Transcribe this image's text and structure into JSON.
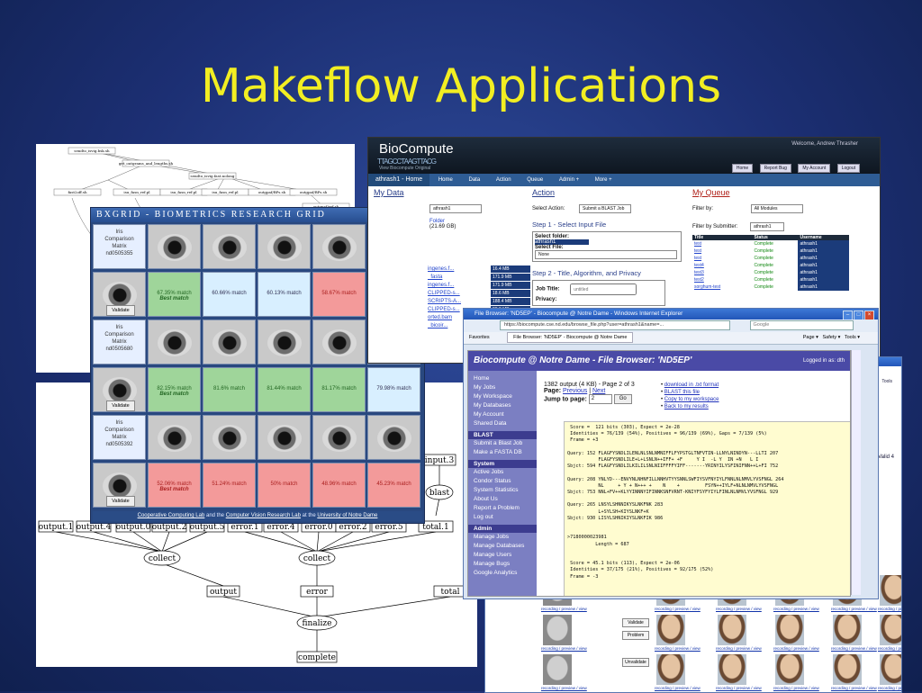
{
  "slide": {
    "title": "Makeflow Applications"
  },
  "workflow_top": {
    "nodes": [
      "sendto_isvig.bsk.sh",
      "get_outgrams_and_lengths.sh",
      "sendto_isvig.fast.nolong",
      "fast2off.sh",
      "isu_fasn_ref.pl",
      "isu_fasn_ref.pl",
      "isu_fasn_ref.pl",
      "outgpaf/BPs.sh",
      "outgpaf/BPs.sh",
      "outgpaf/ref.sh"
    ]
  },
  "workflow_bottom": {
    "top_nodes": [
      "input.3",
      "blast"
    ],
    "outputs": [
      "output.1",
      "output.4",
      "output.0",
      "output.2",
      "output.5",
      "error.1",
      "error.4",
      "error.0",
      "error.2",
      "error.5",
      "total.1"
    ],
    "collectors": [
      "collect",
      "collect"
    ],
    "mid": [
      "output",
      "error",
      "total"
    ],
    "finalize": "finalize",
    "complete": "complete"
  },
  "bxgrid": {
    "header": "BXGRID - BIOMETRICS RESEARCH GRID",
    "rows": [
      {
        "label": [
          "Iris",
          "Comparison",
          "Matrix",
          "nd0505355"
        ],
        "cells": [
          {
            "text": "67.35% match",
            "best": "Best match",
            "style": "pct-g"
          },
          {
            "text": "60.66% match",
            "style": "pct-b"
          },
          {
            "text": "60.13% match",
            "style": "pct-b"
          },
          {
            "text": "58.67% match",
            "style": "pct-r"
          },
          {
            "text": "56.33% match",
            "style": "pct-r"
          }
        ]
      },
      {
        "label": [
          "Iris",
          "Comparison",
          "Matrix",
          "nd0505680"
        ],
        "cells": [
          {
            "text": "82.15% match",
            "best": "Best match",
            "style": "pct-g"
          },
          {
            "text": "81.6% match",
            "style": "pct-g"
          },
          {
            "text": "81.44% match",
            "style": "pct-g"
          },
          {
            "text": "81.17% match",
            "style": "pct-g"
          },
          {
            "text": "79.98% match",
            "style": "pct-b"
          }
        ]
      },
      {
        "label": [
          "Iris",
          "Comparison",
          "Matrix",
          "nd0505392"
        ],
        "cells": [
          {
            "text": "52.06% match",
            "best": "Best match",
            "style": "pct-r"
          },
          {
            "text": "51.24% match",
            "style": "pct-r"
          },
          {
            "text": "50% match",
            "style": "pct-r"
          },
          {
            "text": "48.96% match",
            "style": "pct-r"
          },
          {
            "text": "45.23% match",
            "style": "pct-r"
          }
        ]
      }
    ],
    "validate_label": "Validate",
    "footer": {
      "lab1": "Cooperative Computing Lab",
      "and": "and the",
      "lab2": "Computer Vision Research Lab",
      "at": "at the",
      "univ": "University of Notre Dame"
    }
  },
  "biocompute": {
    "brand": "BioCompute",
    "strand": "TTAGCCTAAGTTACG",
    "sub": "View Biocompute Original",
    "welcome": "Welcome, Andrew Thrasher",
    "top_buttons": [
      "Home",
      "Report Bug",
      "My Account",
      "Logout"
    ],
    "nav": [
      "athrash1 - Home",
      "Home",
      "Data",
      "Action",
      "Queue",
      "Admin +",
      "More +"
    ],
    "my_data": {
      "title": "My Data",
      "select": "athrash1",
      "folder": "Folder",
      "size": "(21.69 GB)",
      "files": [
        "ingenes.f...",
        "_fasta",
        "ingenes.f...",
        "CLIPPED-s...",
        "SCRIPTS-A...",
        "CLIPPED-s...",
        "orted.bam",
        "_bicoir..."
      ],
      "sizes": [
        "16.4 MB",
        "171.9 MB",
        "171.9 MB",
        "18.6 MB",
        "188.4 MB",
        "28.9 MB"
      ]
    },
    "action": {
      "title": "Action",
      "select_action_label": "Select Action:",
      "select_action": "Submit a BLAST Job",
      "step1": "Step 1 - Select Input File",
      "folder_label": "Select folder:",
      "folder_value": "athrash1",
      "file_label": "Select File:",
      "file_value": "None",
      "step2": "Step 2 - Title, Algorithm, and Privacy",
      "job_title_label": "Job Title:",
      "job_title_placeholder": "untitled",
      "privacy_label": "Privacy:"
    },
    "queue": {
      "title": "My Queue",
      "filter_label": "Filter by:",
      "filter_value": "All Modules",
      "submitter_label": "Filter by Submitter:",
      "submitter_value": "athrash1",
      "headers": [
        "Title",
        "Status",
        "Username"
      ],
      "rows": [
        [
          "test",
          "Complete",
          "athrash1"
        ],
        [
          "test",
          "Complete",
          "athrash1"
        ],
        [
          "test",
          "Complete",
          "athrash1"
        ],
        [
          "test4",
          "Complete",
          "athrash1"
        ],
        [
          "test3",
          "Complete",
          "athrash1"
        ],
        [
          "test2",
          "Complete",
          "athrash1"
        ],
        [
          "sorghum-test",
          "Complete",
          "athrash1"
        ]
      ]
    }
  },
  "ie": {
    "title": "File Browser: 'ND5EP' - Biocompute @ Notre Dame - Windows Internet Explorer",
    "url": "https://biocompute.cse.nd.edu/browse_file.php?user=athrash1&name=...",
    "search": "Google",
    "favorites": "Favorites",
    "tab": "File Browser: 'ND5EP' - Biocompute @ Notre Dame",
    "tools": [
      "Page",
      "Safety",
      "Tools"
    ],
    "banner": "Biocompute @ Notre Dame - File Browser: 'ND5EP'",
    "logged": "Logged in as: dth",
    "side": [
      {
        "items": [
          "Home",
          "My Jobs",
          "My Workspace",
          "My Databases",
          "My Account",
          "Shared Data"
        ]
      },
      {
        "group": "BLAST",
        "items": [
          "Submit a Blast Job",
          "Make a FASTA DB"
        ]
      },
      {
        "group": "System",
        "items": [
          "Active Jobs",
          "Condor Status",
          "System Statistics",
          "About Us",
          "Report a Problem",
          "Log out"
        ]
      },
      {
        "group": "Admin",
        "items": [
          "Manage Jobs",
          "Manage Databases",
          "Manage Users",
          "Manage Bugs",
          "Google Analytics"
        ]
      }
    ],
    "main": {
      "summary": "1382 output (4 KB) - Page 2 of 3",
      "page_label": "Page:",
      "prev": "Previous",
      "next": "Next",
      "jump_label": "Jump to page:",
      "jump_value": "2",
      "go": "Go",
      "bullets": [
        "download in .txt format",
        "BLAST this file",
        "Copy to my workspace",
        "Back to my results"
      ],
      "pre": " Score =  121 bits (303), Expect = 2e-28\n Identities = 76/139 (54%), Positives = 96/139 (69%), Gaps = 7/139 (5%)\n Frame = +3\n\nQuery: 152 FLAGFYSNDLILENLNLSNLNMNIFFLFYPSTGLTNFVTIN-LLNYLNINDYN---LLTI 207\n           FLAGFYSNDLILE+L+LSNLN++IFF+ +F     Y I  -L Y  IN +N   L I\nSbjct: 594 FLAGFYSNDLILKILILSNLNIIFFFFYIFF-------YRINYILYSFINIFNN++L+FI 752\n\nQuery: 208 YNLYD---ENVYNLNHNFILLNNHVTYYSNNLSWFIYSVFNYIYLFNNLNLNMVLYVSFNGL 264\n           NL     + Y + N+++ +    N    +         FSYN++IYLF+NLNLNMVLYVSFNGL\nSbjct: 753 NNL+FV++KLYYINNNYIFINNKSNFVRNT-KNIYFSYFYIYLFINLNLNMVLYVSFNGL 929\n\nQuery: 265 LNSYLSHNNIKYSLNKFNK 283\n           L+SYLSH+KIYSLNKF+K\nSbjct: 930 LISYLSHNIKIYSLNKFIK 986\n\n\n>7180000023981\n          Length = 687\n\n\n Score = 45.1 bits (113), Expect = 2e-06\n Identities = 37/175 (21%), Positives = 92/175 (52%)\n Frame = -3"
    }
  },
  "facegrid": {
    "tools": "Tools",
    "valid_label": "Valid 4",
    "buttons": [
      "Problem",
      "Unvalidate",
      "Validate",
      "Problem",
      "Unvalidate"
    ],
    "caption": "recording / preview / view"
  }
}
